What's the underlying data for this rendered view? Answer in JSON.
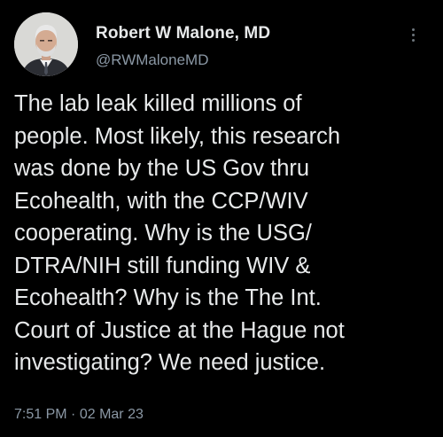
{
  "author": {
    "display_name": "Robert W Malone, MD",
    "handle": "@RWMaloneMD",
    "avatar_icon": "profile-photo"
  },
  "more_icon": "more-options-icon",
  "tweet": {
    "text": "The lab leak killed millions of\npeople. Most likely, this research\nwas done by the US Gov thru\nEcohealth, with the CCP/WIV\ncooperating. Why is the USG/\nDTRA/NIH still funding WIV &\nEcohealth? Why is the The Int.\nCourt of Justice at the Hague not\ninvestigating? We need justice.",
    "time": "7:51 PM",
    "separator": "·",
    "date": "02 Mar 23"
  },
  "colors": {
    "background": "#000000",
    "primary_text": "#e7e9ea",
    "secondary_text": "#8b98a5"
  }
}
